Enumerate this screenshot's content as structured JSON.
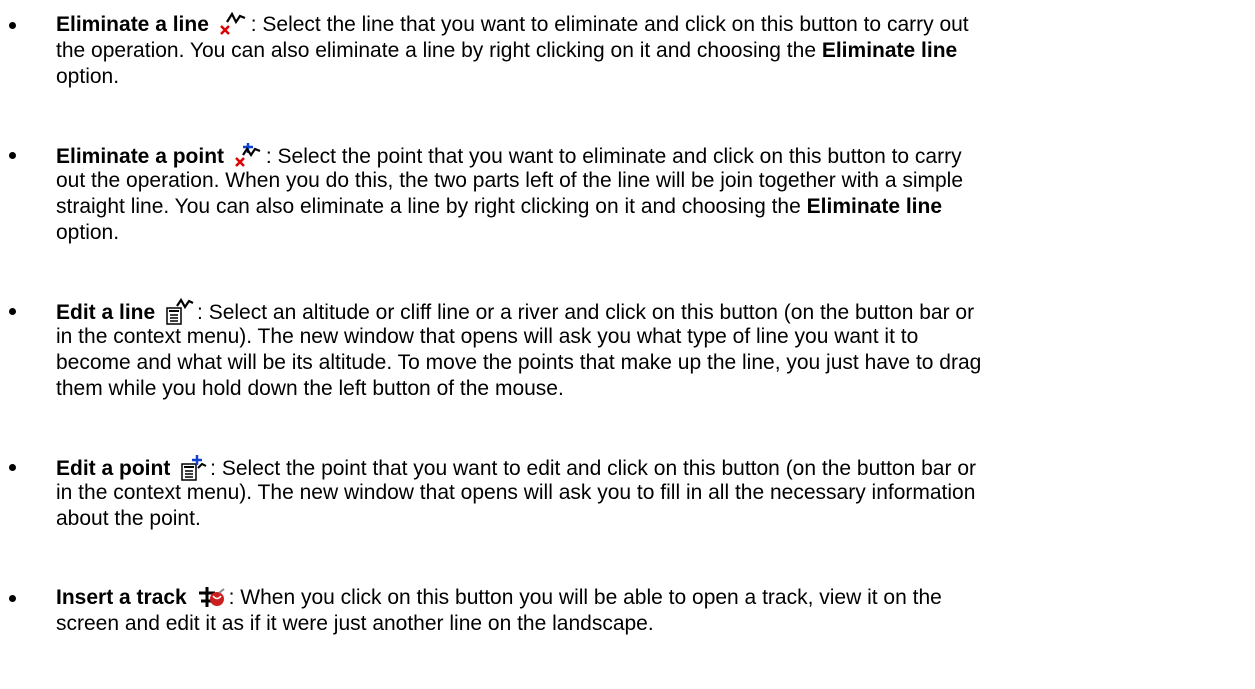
{
  "items": [
    {
      "term": "Eliminate a line",
      "icon": "eliminate-line-icon",
      "lines": [
        ": Select the line that you want to eliminate and click on this button to carry out",
        "the operation. You can also eliminate a line by right clicking on it and choosing the ",
        "option."
      ],
      "bold_term_end": "Eliminate line"
    },
    {
      "term": "Eliminate a point",
      "icon": "eliminate-point-icon",
      "lines": [
        ": Select the point that you want to eliminate and click on this button to carry",
        "out the operation. When you do this, the two parts left of the line will be join together with a simple",
        "straight line. You can also eliminate a line by right clicking on it and choosing the ",
        "option."
      ],
      "bold_term_end": "Eliminate line"
    },
    {
      "term": "Edit a line",
      "icon": "edit-line-icon",
      "lines": [
        ": Select an altitude or cliff line or a river and click on this button (on the button bar or",
        "in the context menu). The new window that opens will ask you what type of line you want it to",
        "become and what will be its altitude. To move the points that make up the line, you just have to drag",
        "them while you hold down the left button of the mouse."
      ]
    },
    {
      "term": "Edit a point",
      "icon": "edit-point-icon",
      "lines": [
        ": Select the point that you want to edit and click on this button (on the button bar or",
        "in the context menu). The new window that opens will ask you to fill in all the necessary information",
        "about the point."
      ]
    },
    {
      "term": "Insert a track",
      "icon": "insert-track-icon",
      "lines": [
        ": When you click on this button you will be able to open a track, view it on the",
        "screen and edit it as if it were just another line on the landscape."
      ]
    }
  ]
}
